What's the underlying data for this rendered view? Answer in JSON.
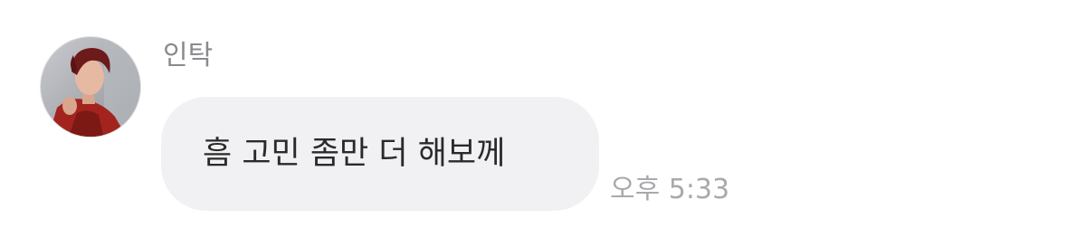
{
  "message": {
    "sender": "인탁",
    "avatar": "profile-photo",
    "text": "흠 고민 좀만 더 해보께",
    "time": "오후 5:33"
  },
  "colors": {
    "bubble": "#f1f1f4",
    "message_text": "#2a2a2a",
    "sender_name": "#8a8a8e",
    "timestamp": "#a9a9ad"
  }
}
